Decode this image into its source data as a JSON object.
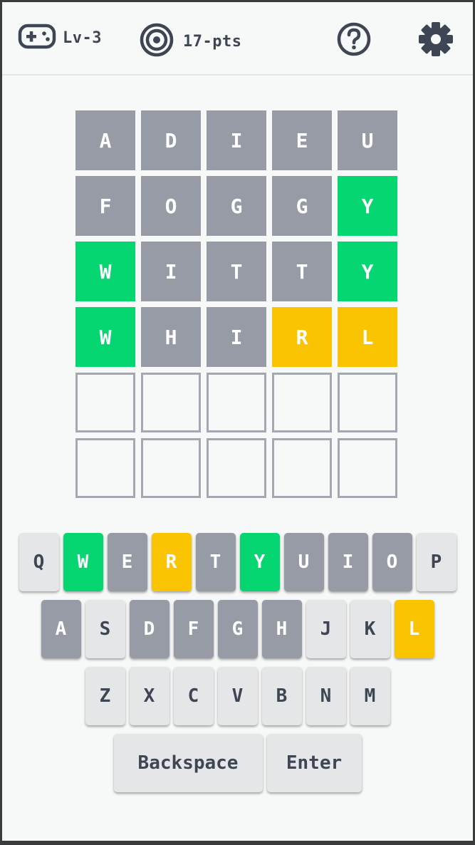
{
  "header": {
    "level_label": "Lv-3",
    "points_label": "17-pts",
    "icons": {
      "level": "gamepad-icon",
      "points": "target-icon",
      "help": "help-icon",
      "settings": "gear-icon"
    }
  },
  "colors": {
    "correct": "#06d671",
    "present": "#fbc402",
    "absent": "#969ba6",
    "empty_border": "#a4a8b2",
    "key_default": "#e4e6e8",
    "text_dark": "#3d4652"
  },
  "board": {
    "rows": [
      {
        "tiles": [
          {
            "letter": "A",
            "state": "absent"
          },
          {
            "letter": "D",
            "state": "absent"
          },
          {
            "letter": "I",
            "state": "absent"
          },
          {
            "letter": "E",
            "state": "absent"
          },
          {
            "letter": "U",
            "state": "absent"
          }
        ]
      },
      {
        "tiles": [
          {
            "letter": "F",
            "state": "absent"
          },
          {
            "letter": "O",
            "state": "absent"
          },
          {
            "letter": "G",
            "state": "absent"
          },
          {
            "letter": "G",
            "state": "absent"
          },
          {
            "letter": "Y",
            "state": "correct"
          }
        ]
      },
      {
        "tiles": [
          {
            "letter": "W",
            "state": "correct"
          },
          {
            "letter": "I",
            "state": "absent"
          },
          {
            "letter": "T",
            "state": "absent"
          },
          {
            "letter": "T",
            "state": "absent"
          },
          {
            "letter": "Y",
            "state": "correct"
          }
        ]
      },
      {
        "tiles": [
          {
            "letter": "W",
            "state": "correct"
          },
          {
            "letter": "H",
            "state": "absent"
          },
          {
            "letter": "I",
            "state": "absent"
          },
          {
            "letter": "R",
            "state": "present"
          },
          {
            "letter": "L",
            "state": "present"
          }
        ]
      },
      {
        "tiles": [
          {
            "letter": "",
            "state": "empty"
          },
          {
            "letter": "",
            "state": "empty"
          },
          {
            "letter": "",
            "state": "empty"
          },
          {
            "letter": "",
            "state": "empty"
          },
          {
            "letter": "",
            "state": "empty"
          }
        ]
      },
      {
        "tiles": [
          {
            "letter": "",
            "state": "empty"
          },
          {
            "letter": "",
            "state": "empty"
          },
          {
            "letter": "",
            "state": "empty"
          },
          {
            "letter": "",
            "state": "empty"
          },
          {
            "letter": "",
            "state": "empty"
          }
        ]
      }
    ]
  },
  "keyboard": {
    "rows": [
      [
        {
          "label": "Q",
          "state": "default"
        },
        {
          "label": "W",
          "state": "correct"
        },
        {
          "label": "E",
          "state": "absent"
        },
        {
          "label": "R",
          "state": "present"
        },
        {
          "label": "T",
          "state": "absent"
        },
        {
          "label": "Y",
          "state": "correct"
        },
        {
          "label": "U",
          "state": "absent"
        },
        {
          "label": "I",
          "state": "absent"
        },
        {
          "label": "O",
          "state": "absent"
        },
        {
          "label": "P",
          "state": "default"
        }
      ],
      [
        {
          "label": "A",
          "state": "absent"
        },
        {
          "label": "S",
          "state": "default"
        },
        {
          "label": "D",
          "state": "absent"
        },
        {
          "label": "F",
          "state": "absent"
        },
        {
          "label": "G",
          "state": "absent"
        },
        {
          "label": "H",
          "state": "absent"
        },
        {
          "label": "J",
          "state": "default"
        },
        {
          "label": "K",
          "state": "default"
        },
        {
          "label": "L",
          "state": "present"
        }
      ],
      [
        {
          "label": "Z",
          "state": "default"
        },
        {
          "label": "X",
          "state": "default"
        },
        {
          "label": "C",
          "state": "default"
        },
        {
          "label": "V",
          "state": "default"
        },
        {
          "label": "B",
          "state": "default"
        },
        {
          "label": "N",
          "state": "default"
        },
        {
          "label": "M",
          "state": "default"
        }
      ],
      [
        {
          "label": "Backspace",
          "state": "default",
          "kind": "backspace"
        },
        {
          "label": "Enter",
          "state": "default",
          "kind": "enter"
        }
      ]
    ]
  }
}
